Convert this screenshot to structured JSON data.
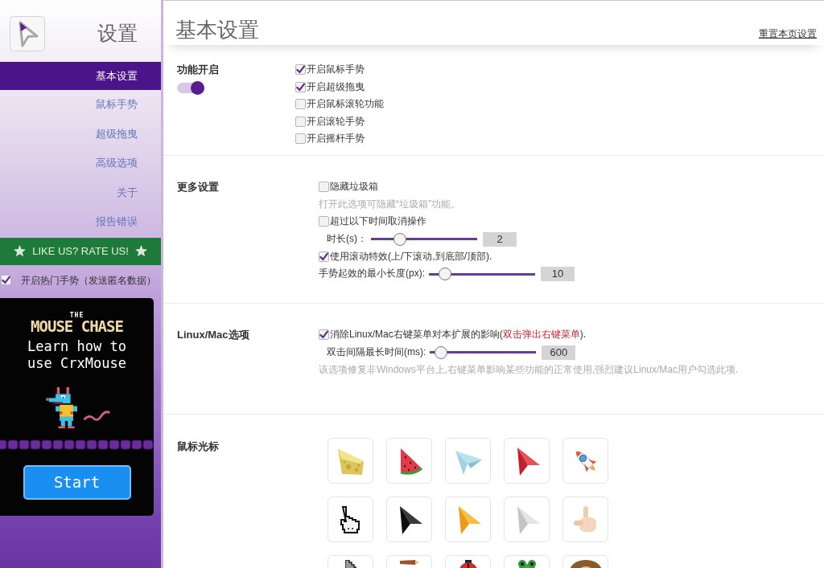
{
  "sidebar": {
    "title": "设置",
    "nav": [
      {
        "label": "基本设置",
        "selected": true
      },
      {
        "label": "鼠标手势",
        "selected": false
      },
      {
        "label": "超级拖曳",
        "selected": false
      },
      {
        "label": "高级选项",
        "selected": false
      },
      {
        "label": "关于",
        "selected": false
      },
      {
        "label": "报告错误",
        "selected": false
      }
    ],
    "rate_banner": "LIKE US? RATE US!",
    "hot_gestures": {
      "label": "开启热门手势（发送匿名数据）",
      "checked": true
    },
    "ad": {
      "logo_small": "THE",
      "logo": "MOUSE CHASE",
      "text": "Learn how to use CrxMouse",
      "button": "Start"
    }
  },
  "main": {
    "title": "基本设置",
    "reset_link": "重置本页设置",
    "sections": [
      {
        "kind": "switches",
        "label": "功能开启",
        "toggle": {
          "on": true
        },
        "items": [
          {
            "kind": "checkbox",
            "label": "开启鼠标手势",
            "checked": true
          },
          {
            "kind": "checkbox",
            "label": "开启超级拖曳",
            "checked": true
          },
          {
            "kind": "checkbox",
            "label": "开启鼠标滚轮功能",
            "checked": false
          },
          {
            "kind": "checkbox",
            "label": "开启滚轮手势",
            "checked": false
          },
          {
            "kind": "checkbox",
            "label": "开启摇杆手势",
            "checked": false
          }
        ]
      },
      {
        "kind": "options",
        "label": "更多设置",
        "items": [
          {
            "kind": "checkbox",
            "label": "隐藏垃圾箱",
            "checked": false
          },
          {
            "kind": "hint",
            "text": "打开此选项可隐藏“垃圾箱”功能。"
          },
          {
            "kind": "checkbox",
            "label": "超过以下时间取消操作",
            "checked": false,
            "children": [
              {
                "kind": "slider",
                "label": "时长(s)：",
                "level": 0.24,
                "value": "2"
              }
            ]
          },
          {
            "kind": "checkbox",
            "label": "使用滚动特效(上/下滚动,到底部/顶部).",
            "checked": true
          },
          {
            "kind": "slider",
            "label": "手势起效的最小长度(px):",
            "level": 0.1,
            "value": "10"
          }
        ]
      },
      {
        "kind": "options",
        "label": "Linux/Mac选项",
        "items": [
          {
            "kind": "checkbox",
            "label_parts": [
              {
                "kind": "plain",
                "text": "消除Linux/Mac右键菜单对本扩展的影响("
              },
              {
                "kind": "warning",
                "text": "双击弹出右键菜单"
              },
              {
                "kind": "plain",
                "text": ")."
              }
            ],
            "checked": true,
            "children": [
              {
                "kind": "slider",
                "label": "双击间隔最长时间(ms):",
                "level": 0.05,
                "value": "600"
              }
            ]
          },
          {
            "kind": "hint",
            "text": "该选项修复非Windows平台上,右键菜单影响某些功能的正常使用,强烈建议Linux/Mac用户勾选此项."
          }
        ]
      },
      {
        "kind": "cursors",
        "label": "鼠标光标",
        "cursors": [
          {
            "kind": "cheese"
          },
          {
            "kind": "watermelon"
          },
          {
            "kind": "paper_plane"
          },
          {
            "kind": "arrow_red"
          },
          {
            "kind": "rocket"
          },
          {
            "kind": "pixel_hand"
          },
          {
            "kind": "arrow_black"
          },
          {
            "kind": "arrow_orange"
          },
          {
            "kind": "arrow_grey"
          },
          {
            "kind": "pointing_hand"
          },
          {
            "kind": "pixel_arrow"
          },
          {
            "kind": "pencil"
          },
          {
            "kind": "ladybug"
          },
          {
            "kind": "frog"
          },
          {
            "kind": "monkey"
          }
        ]
      }
    ]
  }
}
